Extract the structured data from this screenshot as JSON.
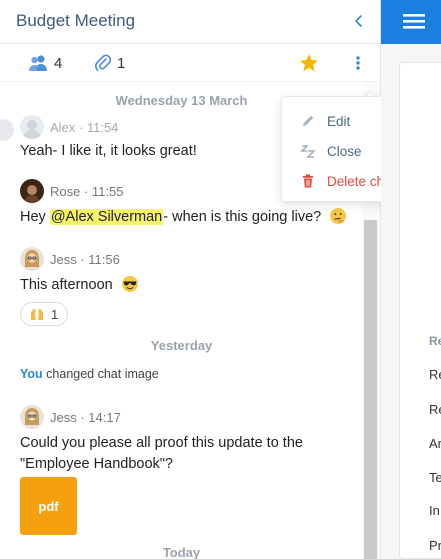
{
  "chat": {
    "title": "Budget Meeting",
    "participants_count": "4",
    "attachments_count": "1",
    "date_sep_1": "Wednesday 13 March",
    "date_sep_2": "Yesterday",
    "date_sep_3": "Today"
  },
  "messages": [
    {
      "author": "Alex · 11:54",
      "text": "Yeah- I like it, it looks great!"
    },
    {
      "author": "Rose · 11:55",
      "text_before": "Hey ",
      "mention": "@Alex Silverman",
      "text_after": "- when is this going live?"
    },
    {
      "author": "Jess · 11:56",
      "text": "This afternoon",
      "reaction_count": "1"
    },
    {
      "author": "Jess · 14:17",
      "text": "Could you please all proof this update to the \"Employee Handbook\"?",
      "attachment_label": "pdf"
    }
  ],
  "system_message": {
    "actor": "You",
    "text": " changed chat image"
  },
  "menu": {
    "edit": "Edit",
    "close": "Close",
    "delete": "Delete chat"
  },
  "right_panel": {
    "heading": "Re",
    "items": [
      "Re",
      "Re",
      "Ar",
      "Te",
      "In",
      "Pr"
    ]
  },
  "colors": {
    "title": "#3d5a80",
    "accent_blue": "#1a7fde",
    "star": "#f5b800",
    "delete": "#e04a3f",
    "mention_highlight": "#f7f36b",
    "pdf_tile": "#f5a00f"
  },
  "icons": [
    "users-icon",
    "paperclip-icon",
    "star-icon",
    "kebab-menu-icon",
    "chevron-left-icon",
    "pencil-icon",
    "sleep-icon",
    "trash-icon",
    "hamburger-icon"
  ]
}
